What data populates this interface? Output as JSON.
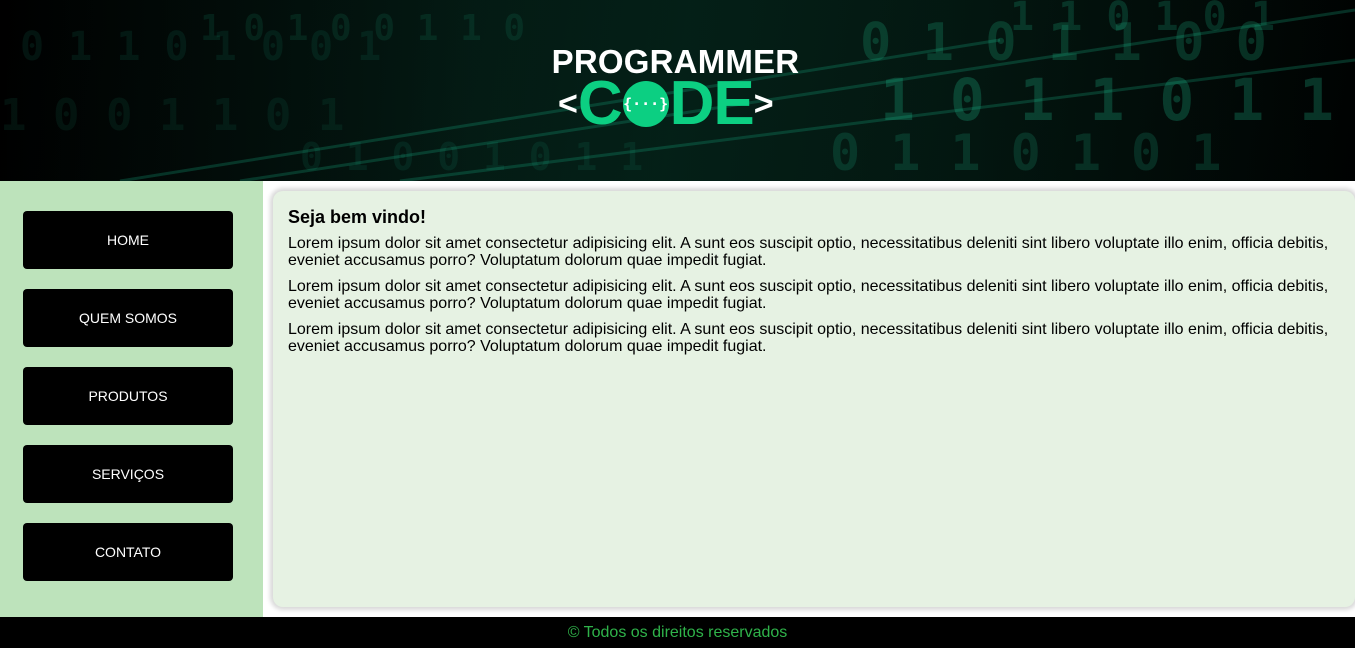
{
  "header": {
    "logo_top": "PROGRAMMER",
    "logo_bracket_left": "<",
    "logo_letter_c": "C",
    "logo_o_symbol": "{···}",
    "logo_letters_de": "DE",
    "logo_bracket_right": ">",
    "background_icon": "binary-code-background",
    "colors": {
      "logo_accent": "#0ccf82",
      "logo_text": "#ffffff"
    }
  },
  "sidebar": {
    "background": "#bde3bb",
    "items": [
      {
        "label": "HOME"
      },
      {
        "label": "QUEM SOMOS"
      },
      {
        "label": "PRODUTOS"
      },
      {
        "label": "SERVIÇOS"
      },
      {
        "label": "CONTATO"
      }
    ]
  },
  "main": {
    "title": "Seja bem vindo!",
    "paragraphs": [
      "Lorem ipsum dolor sit amet consectetur adipisicing elit. A sunt eos suscipit optio, necessitatibus deleniti sint libero voluptate illo enim, officia debitis, eveniet accusamus porro? Voluptatum dolorum quae impedit fugiat.",
      "Lorem ipsum dolor sit amet consectetur adipisicing elit. A sunt eos suscipit optio, necessitatibus deleniti sint libero voluptate illo enim, officia debitis, eveniet accusamus porro? Voluptatum dolorum quae impedit fugiat.",
      "Lorem ipsum dolor sit amet consectetur adipisicing elit. A sunt eos suscipit optio, necessitatibus deleniti sint libero voluptate illo enim, officia debitis, eveniet accusamus porro? Voluptatum dolorum quae impedit fugiat."
    ],
    "card_background": "#e6f2e3"
  },
  "footer": {
    "text": "© Todos os direitos reservados",
    "text_color": "#2fb34a"
  }
}
